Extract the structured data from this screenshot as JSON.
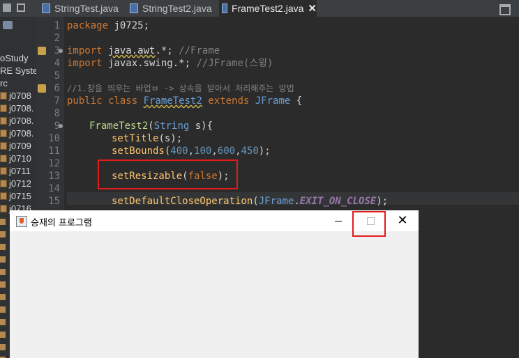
{
  "tabs": [
    {
      "label": "StringTest.java"
    },
    {
      "label": "StringTest2.java"
    },
    {
      "label": "FrameTest2.java",
      "close": "✕"
    }
  ],
  "explorer": {
    "items": [
      "oStudy",
      "RE Syster",
      "rc",
      "j0708",
      "j0708.",
      "j0708.",
      "j0708.",
      "j0709",
      "j0710",
      "j0711",
      "j0712",
      "j0715",
      "j0716"
    ]
  },
  "editor": {
    "line_numbers": [
      "1",
      "2",
      "3",
      "4",
      "5",
      "6",
      "7",
      "8",
      "9",
      "10",
      "11",
      "12",
      "13",
      "14",
      "15"
    ],
    "lines": {
      "l1_kw": "package",
      "l1_rest": " j0725;",
      "l3_kw": "import",
      "l3_pkg": "java.awt",
      "l3_rest": ".*; ",
      "l3_cmt": "//Frame",
      "l4_kw": "import",
      "l4_rest": " javax.swing.*; ",
      "l4_cmt": "//JFrame(스윙)",
      "l6_cmt": "//1.창을 띄우는 바업ㅂ -> 상속을 받아서 처리해주는 방법",
      "l7_kw1": "public class ",
      "l7_cls": "FrameTest2",
      "l7_kw2": " extends ",
      "l7_cls2": "JFrame",
      "l7_rest": " {",
      "l9_fn": "FrameTest2",
      "l9_a": "(",
      "l9_cls": "String",
      "l9_b": " s){",
      "l10_fn": "setTitle",
      "l10_rest": "(s);",
      "l11_fn": "setBounds",
      "l11_a": "(",
      "l11_n1": "400",
      "l11_c1": ",",
      "l11_n2": "100",
      "l11_c2": ",",
      "l11_n3": "600",
      "l11_c3": ",",
      "l11_n4": "450",
      "l11_b": ");",
      "l13_fn": "setResizable",
      "l13_a": "(",
      "l13_bool": "false",
      "l13_b": ");",
      "l15_fn": "setDefaultCloseOperation",
      "l15_a": "(",
      "l15_cls": "JFrame",
      "l15_dot": ".",
      "l15_const": "EXIT_ON_CLOSE",
      "l15_b": ");"
    }
  },
  "frame": {
    "title": "승재의 프로그램",
    "close_glyph": "✕"
  },
  "colors": {
    "highlight_box": "#e21b1b",
    "editor_bg": "#2b2b2b",
    "frame_bg": "#f0f0f0"
  }
}
